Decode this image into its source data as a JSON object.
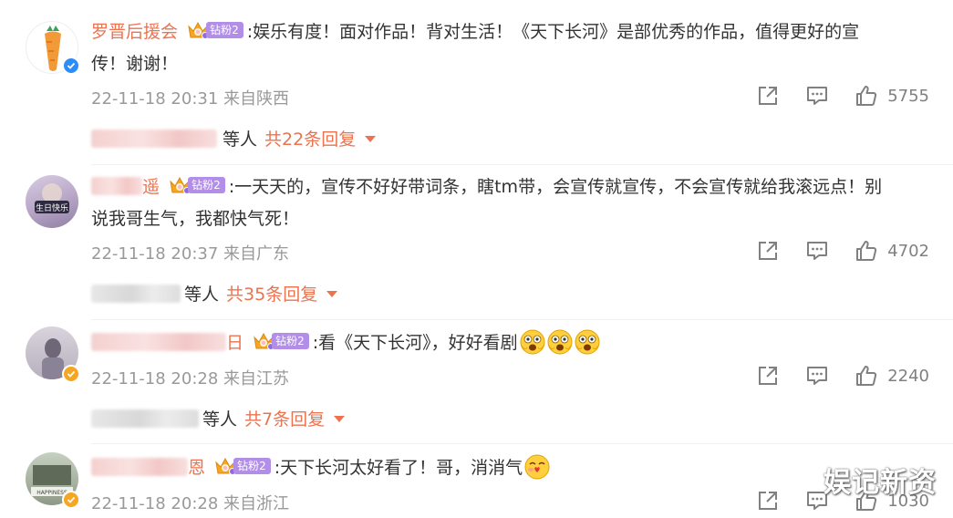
{
  "comments": [
    {
      "username": "罗晋后援会",
      "fan_badge": "钻粉2",
      "text_line1": ":娱乐有度！面对作品！背对生活！《天下长河》是部优秀的作品，值得更好的宣",
      "text_line2": "传！谢谢！",
      "time": "22-11-18 20:31 来自陕西",
      "likes": "5755",
      "reply_suffix": "等人",
      "reply_total": "共22条回复",
      "avatar_badge": "verified-blue"
    },
    {
      "username_tail": "遥",
      "fan_badge": "钻粉2",
      "text_line1": ":一天天的，宣传不好好带词条，瞎tm带，会宣传就宣传，不会宣传就给我滚远点！别",
      "text_line2": "说我哥生气，我都快气死！",
      "time": "22-11-18 20:37 来自广东",
      "likes": "4702",
      "reply_suffix": "等人",
      "reply_total": "共35条回复",
      "avatar_text": "生日快乐"
    },
    {
      "username_tail": "日",
      "fan_badge": "钻粉2",
      "text_line1": ":看《天下长河》，好好看剧",
      "time": "22-11-18 20:28 来自江苏",
      "likes": "2240",
      "reply_suffix": "等人",
      "reply_total": "共7条回复",
      "emojis": [
        "scared-face-emoji",
        "scared-face-emoji",
        "scared-face-emoji"
      ]
    },
    {
      "username_tail": "恩",
      "fan_badge": "钻粉2",
      "text_line1": ":天下长河太好看了！哥，消消气",
      "time": "22-11-18 20:28 来自浙江",
      "likes": "1030",
      "avatar_text": "HAPPINESS",
      "emojis": [
        "kiss-face-emoji"
      ]
    }
  ],
  "watermark": "娱记新资",
  "colors": {
    "username": "#eb7350",
    "meta": "#999999",
    "fan_badge": "#b28ee8",
    "crown": "#f5a623"
  },
  "icons": [
    "share-icon",
    "comment-icon",
    "like-icon",
    "caret-down-icon",
    "crown-icon",
    "verified-icon"
  ]
}
